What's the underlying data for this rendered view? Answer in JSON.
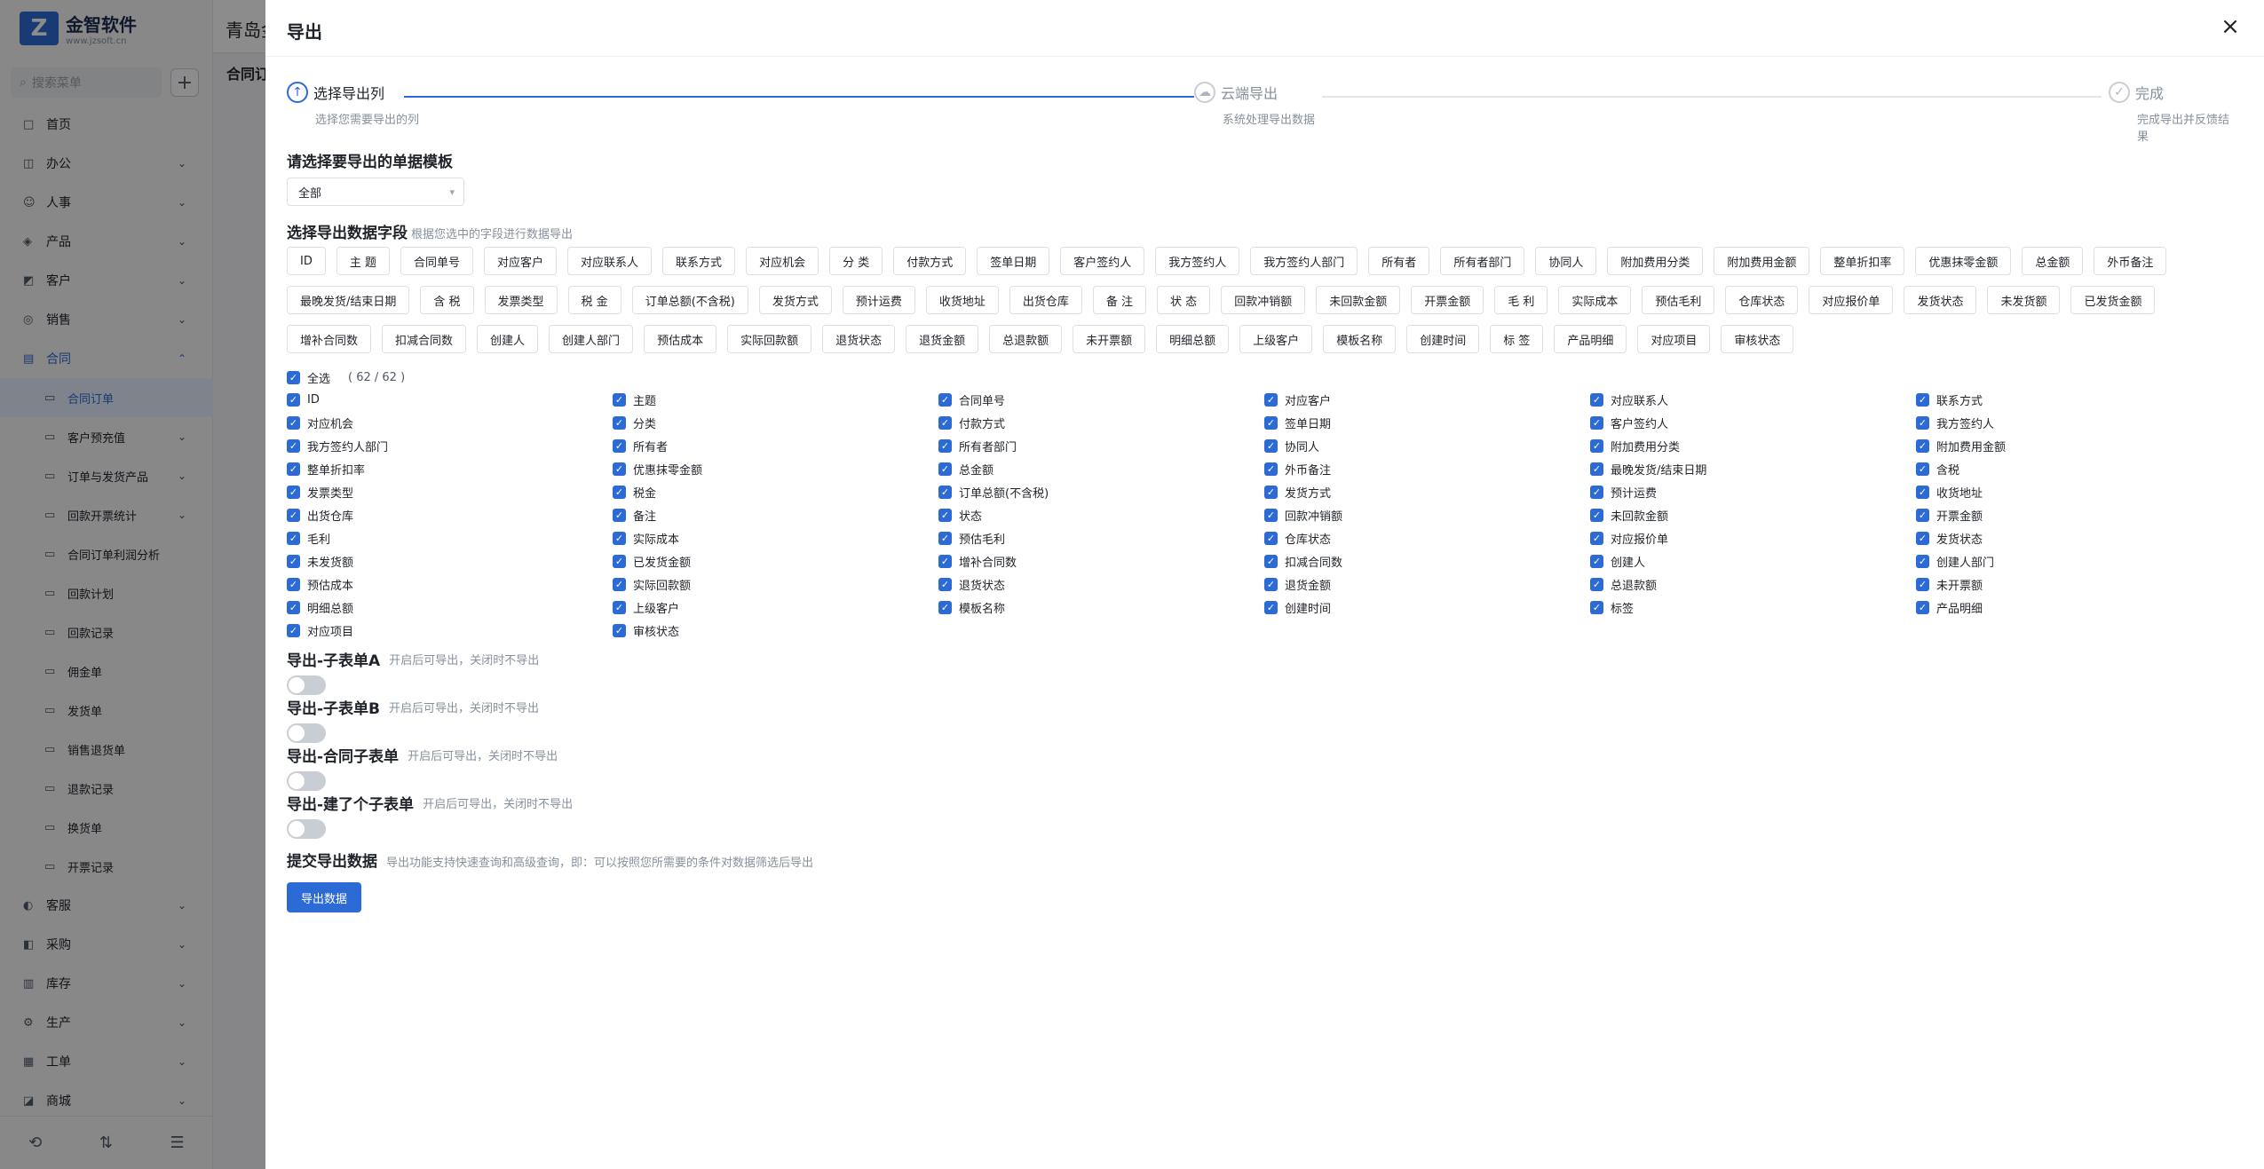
{
  "app": {
    "logo_text": "金智软件",
    "logo_sub": "www.jzsoft.cn",
    "search_placeholder": "搜索菜单",
    "header_title": "青岛金",
    "bg_tab": "合同订"
  },
  "sidebar": {
    "items": [
      {
        "label": "首页",
        "icon": "□",
        "chevron": false
      },
      {
        "label": "办公",
        "icon": "◫",
        "chevron": true
      },
      {
        "label": "人事",
        "icon": "☺",
        "chevron": true
      },
      {
        "label": "产品",
        "icon": "◈",
        "chevron": true
      },
      {
        "label": "客户",
        "icon": "◩",
        "chevron": true
      },
      {
        "label": "销售",
        "icon": "◎",
        "chevron": true
      },
      {
        "label": "合同",
        "icon": "▤",
        "chevron": true,
        "active": true
      }
    ],
    "sub_items": [
      {
        "label": "合同订单",
        "selected": true
      },
      {
        "label": "客户预充值",
        "chevron": true
      },
      {
        "label": "订单与发货产品",
        "chevron": true
      },
      {
        "label": "回款开票统计",
        "chevron": true
      },
      {
        "label": "合同订单利润分析"
      },
      {
        "label": "回款计划"
      },
      {
        "label": "回款记录"
      },
      {
        "label": "佣金单"
      },
      {
        "label": "发货单"
      },
      {
        "label": "销售退货单"
      },
      {
        "label": "退款记录"
      },
      {
        "label": "换货单"
      },
      {
        "label": "开票记录"
      }
    ],
    "bottom_items": [
      {
        "label": "客服",
        "icon": "◐"
      },
      {
        "label": "采购",
        "icon": "◧"
      },
      {
        "label": "库存",
        "icon": "▥"
      },
      {
        "label": "生产",
        "icon": "⚙"
      },
      {
        "label": "工单",
        "icon": "▦"
      },
      {
        "label": "商城",
        "icon": "◪"
      }
    ]
  },
  "drawer": {
    "title": "导出",
    "steps": [
      {
        "title": "选择导出列",
        "desc": "选择您需要导出的列"
      },
      {
        "title": "云端导出",
        "desc": "系统处理导出数据"
      },
      {
        "title": "完成",
        "desc": "完成导出并反馈结果"
      }
    ],
    "template_title": "请选择要导出的单据模板",
    "template_value": "全部",
    "fields_title": "选择导出数据字段",
    "fields_hint": "根据您选中的字段进行数据导出",
    "select_all_label": "全选",
    "select_count": "( 62 / 62 )",
    "sub_sections": [
      {
        "title": "导出-子表单A",
        "hint": "开启后可导出，关闭时不导出"
      },
      {
        "title": "导出-子表单B",
        "hint": "开启后可导出，关闭时不导出"
      },
      {
        "title": "导出-合同子表单",
        "hint": "开启后可导出，关闭时不导出"
      },
      {
        "title": "导出-建了个子表单",
        "hint": "开启后可导出，关闭时不导出"
      }
    ],
    "submit_title": "提交导出数据",
    "submit_hint": "导出功能支持快速查询和高级查询，即：可以按照您所需要的条件对数据筛选后导出",
    "export_button": "导出数据"
  },
  "tags": [
    "ID",
    "主 题",
    "合同单号",
    "对应客户",
    "对应联系人",
    "联系方式",
    "对应机会",
    "分 类",
    "付款方式",
    "签单日期",
    "客户签约人",
    "我方签约人",
    "我方签约人部门",
    "所有者",
    "所有者部门",
    "协同人",
    "附加费用分类",
    "附加费用金额",
    "整单折扣率",
    "优惠抹零金额",
    "总金额",
    "外币备注",
    "最晚发货/结束日期",
    "含 税",
    "发票类型",
    "税 金",
    "订单总额(不含税)",
    "发货方式",
    "预计运费",
    "收货地址",
    "出货仓库",
    "备 注",
    "状 态",
    "回款冲销额",
    "未回款金额",
    "开票金额",
    "毛 利",
    "实际成本",
    "预估毛利",
    "仓库状态",
    "对应报价单",
    "发货状态",
    "未发货额",
    "已发货金额",
    "增补合同数",
    "扣减合同数",
    "创建人",
    "创建人部门",
    "预估成本",
    "实际回款额",
    "退货状态",
    "退货金额",
    "总退款额",
    "未开票额",
    "明细总额",
    "上级客户",
    "模板名称",
    "创建时间",
    "标 签",
    "产品明细",
    "对应项目",
    "审核状态"
  ],
  "checkboxes": [
    "ID",
    "主题",
    "合同单号",
    "对应客户",
    "对应联系人",
    "联系方式",
    "对应机会",
    "分类",
    "付款方式",
    "签单日期",
    "客户签约人",
    "我方签约人",
    "我方签约人部门",
    "所有者",
    "所有者部门",
    "协同人",
    "附加费用分类",
    "附加费用金额",
    "整单折扣率",
    "优惠抹零金额",
    "总金额",
    "外币备注",
    "最晚发货/结束日期",
    "含税",
    "发票类型",
    "税金",
    "订单总额(不含税)",
    "发货方式",
    "预计运费",
    "收货地址",
    "出货仓库",
    "备注",
    "状态",
    "回款冲销额",
    "未回款金额",
    "开票金额",
    "毛利",
    "实际成本",
    "预估毛利",
    "仓库状态",
    "对应报价单",
    "发货状态",
    "未发货额",
    "已发货金额",
    "增补合同数",
    "扣减合同数",
    "创建人",
    "创建人部门",
    "预估成本",
    "实际回款额",
    "退货状态",
    "退货金额",
    "总退款额",
    "未开票额",
    "明细总额",
    "上级客户",
    "模板名称",
    "创建时间",
    "标签",
    "产品明细",
    "对应项目",
    "审核状态"
  ],
  "colors": {
    "primary": "#2c6ad6",
    "overlay": "rgba(0,0,0,0.45)"
  }
}
